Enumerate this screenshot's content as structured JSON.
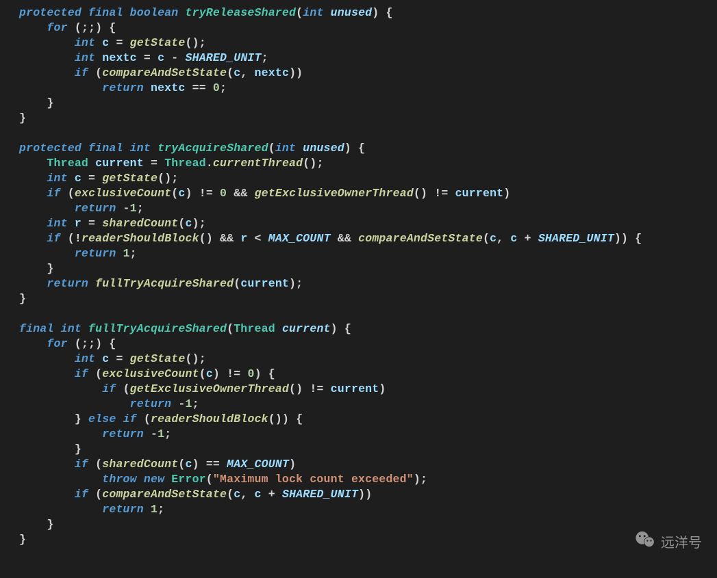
{
  "watermark": {
    "text": "远洋号"
  },
  "code": {
    "lines": [
      [
        [
          "kw",
          "protected"
        ],
        [
          "op",
          " "
        ],
        [
          "kw",
          "final"
        ],
        [
          "op",
          " "
        ],
        [
          "kw",
          "boolean"
        ],
        [
          "op",
          " "
        ],
        [
          "fn",
          "tryReleaseShared"
        ],
        [
          "pun",
          "("
        ],
        [
          "type",
          "int"
        ],
        [
          "op",
          " "
        ],
        [
          "par",
          "unused"
        ],
        [
          "pun",
          ")"
        ],
        [
          "op",
          " "
        ],
        [
          "pun",
          "{"
        ]
      ],
      [
        [
          "op",
          "    "
        ],
        [
          "kw",
          "for"
        ],
        [
          "op",
          " "
        ],
        [
          "pun",
          "("
        ],
        [
          "pun",
          ";"
        ],
        [
          "pun",
          ";"
        ],
        [
          "pun",
          ")"
        ],
        [
          "op",
          " "
        ],
        [
          "pun",
          "{"
        ]
      ],
      [
        [
          "op",
          "        "
        ],
        [
          "type",
          "int"
        ],
        [
          "op",
          " "
        ],
        [
          "id",
          "c"
        ],
        [
          "op",
          " = "
        ],
        [
          "call",
          "getState"
        ],
        [
          "pun",
          "("
        ],
        [
          "pun",
          ")"
        ],
        [
          "pun",
          ";"
        ]
      ],
      [
        [
          "op",
          "        "
        ],
        [
          "type",
          "int"
        ],
        [
          "op",
          " "
        ],
        [
          "id",
          "nextc"
        ],
        [
          "op",
          " = "
        ],
        [
          "id",
          "c"
        ],
        [
          "op",
          " - "
        ],
        [
          "cst",
          "SHARED_UNIT"
        ],
        [
          "pun",
          ";"
        ]
      ],
      [
        [
          "op",
          "        "
        ],
        [
          "kw",
          "if"
        ],
        [
          "op",
          " "
        ],
        [
          "pun",
          "("
        ],
        [
          "call",
          "compareAndSetState"
        ],
        [
          "pun",
          "("
        ],
        [
          "id",
          "c"
        ],
        [
          "pun",
          ","
        ],
        [
          "op",
          " "
        ],
        [
          "id",
          "nextc"
        ],
        [
          "pun",
          ")"
        ],
        [
          "pun",
          ")"
        ]
      ],
      [
        [
          "op",
          "            "
        ],
        [
          "kw",
          "return"
        ],
        [
          "op",
          " "
        ],
        [
          "id",
          "nextc"
        ],
        [
          "op",
          " == "
        ],
        [
          "num",
          "0"
        ],
        [
          "pun",
          ";"
        ]
      ],
      [
        [
          "op",
          "    "
        ],
        [
          "pun",
          "}"
        ]
      ],
      [
        [
          "pun",
          "}"
        ]
      ],
      [
        [
          "op",
          ""
        ]
      ],
      [
        [
          "kw",
          "protected"
        ],
        [
          "op",
          " "
        ],
        [
          "kw",
          "final"
        ],
        [
          "op",
          " "
        ],
        [
          "kw",
          "int"
        ],
        [
          "op",
          " "
        ],
        [
          "fn",
          "tryAcquireShared"
        ],
        [
          "pun",
          "("
        ],
        [
          "type",
          "int"
        ],
        [
          "op",
          " "
        ],
        [
          "par",
          "unused"
        ],
        [
          "pun",
          ")"
        ],
        [
          "op",
          " "
        ],
        [
          "pun",
          "{"
        ]
      ],
      [
        [
          "op",
          "    "
        ],
        [
          "cls",
          "Thread"
        ],
        [
          "op",
          " "
        ],
        [
          "id",
          "current"
        ],
        [
          "op",
          " = "
        ],
        [
          "cls",
          "Thread"
        ],
        [
          "pun",
          "."
        ],
        [
          "call",
          "currentThread"
        ],
        [
          "pun",
          "("
        ],
        [
          "pun",
          ")"
        ],
        [
          "pun",
          ";"
        ]
      ],
      [
        [
          "op",
          "    "
        ],
        [
          "type",
          "int"
        ],
        [
          "op",
          " "
        ],
        [
          "id",
          "c"
        ],
        [
          "op",
          " = "
        ],
        [
          "call",
          "getState"
        ],
        [
          "pun",
          "("
        ],
        [
          "pun",
          ")"
        ],
        [
          "pun",
          ";"
        ]
      ],
      [
        [
          "op",
          "    "
        ],
        [
          "kw",
          "if"
        ],
        [
          "op",
          " "
        ],
        [
          "pun",
          "("
        ],
        [
          "call",
          "exclusiveCount"
        ],
        [
          "pun",
          "("
        ],
        [
          "id",
          "c"
        ],
        [
          "pun",
          ")"
        ],
        [
          "op",
          " != "
        ],
        [
          "num",
          "0"
        ],
        [
          "op",
          " && "
        ],
        [
          "call",
          "getExclusiveOwnerThread"
        ],
        [
          "pun",
          "("
        ],
        [
          "pun",
          ")"
        ],
        [
          "op",
          " != "
        ],
        [
          "id",
          "current"
        ],
        [
          "pun",
          ")"
        ]
      ],
      [
        [
          "op",
          "        "
        ],
        [
          "kw",
          "return"
        ],
        [
          "op",
          " -"
        ],
        [
          "num",
          "1"
        ],
        [
          "pun",
          ";"
        ]
      ],
      [
        [
          "op",
          "    "
        ],
        [
          "type",
          "int"
        ],
        [
          "op",
          " "
        ],
        [
          "id",
          "r"
        ],
        [
          "op",
          " = "
        ],
        [
          "call",
          "sharedCount"
        ],
        [
          "pun",
          "("
        ],
        [
          "id",
          "c"
        ],
        [
          "pun",
          ")"
        ],
        [
          "pun",
          ";"
        ]
      ],
      [
        [
          "op",
          "    "
        ],
        [
          "kw",
          "if"
        ],
        [
          "op",
          " "
        ],
        [
          "pun",
          "("
        ],
        [
          "op",
          "!"
        ],
        [
          "call",
          "readerShouldBlock"
        ],
        [
          "pun",
          "("
        ],
        [
          "pun",
          ")"
        ],
        [
          "op",
          " && "
        ],
        [
          "id",
          "r"
        ],
        [
          "op",
          " < "
        ],
        [
          "cst",
          "MAX_COUNT"
        ],
        [
          "op",
          " && "
        ],
        [
          "call",
          "compareAndSetState"
        ],
        [
          "pun",
          "("
        ],
        [
          "id",
          "c"
        ],
        [
          "pun",
          ","
        ],
        [
          "op",
          " "
        ],
        [
          "id",
          "c"
        ],
        [
          "op",
          " + "
        ],
        [
          "cst",
          "SHARED_UNIT"
        ],
        [
          "pun",
          ")"
        ],
        [
          "pun",
          ")"
        ],
        [
          "op",
          " "
        ],
        [
          "pun",
          "{"
        ]
      ],
      [
        [
          "op",
          "        "
        ],
        [
          "kw",
          "return"
        ],
        [
          "op",
          " "
        ],
        [
          "num",
          "1"
        ],
        [
          "pun",
          ";"
        ]
      ],
      [
        [
          "op",
          "    "
        ],
        [
          "pun",
          "}"
        ]
      ],
      [
        [
          "op",
          "    "
        ],
        [
          "kw",
          "return"
        ],
        [
          "op",
          " "
        ],
        [
          "call",
          "fullTryAcquireShared"
        ],
        [
          "pun",
          "("
        ],
        [
          "id",
          "current"
        ],
        [
          "pun",
          ")"
        ],
        [
          "pun",
          ";"
        ]
      ],
      [
        [
          "pun",
          "}"
        ]
      ],
      [
        [
          "op",
          ""
        ]
      ],
      [
        [
          "kw",
          "final"
        ],
        [
          "op",
          " "
        ],
        [
          "kw",
          "int"
        ],
        [
          "op",
          " "
        ],
        [
          "fn",
          "fullTryAcquireShared"
        ],
        [
          "pun",
          "("
        ],
        [
          "cls",
          "Thread"
        ],
        [
          "op",
          " "
        ],
        [
          "par",
          "current"
        ],
        [
          "pun",
          ")"
        ],
        [
          "op",
          " "
        ],
        [
          "pun",
          "{"
        ]
      ],
      [
        [
          "op",
          "    "
        ],
        [
          "kw",
          "for"
        ],
        [
          "op",
          " "
        ],
        [
          "pun",
          "("
        ],
        [
          "pun",
          ";"
        ],
        [
          "pun",
          ";"
        ],
        [
          "pun",
          ")"
        ],
        [
          "op",
          " "
        ],
        [
          "pun",
          "{"
        ]
      ],
      [
        [
          "op",
          "        "
        ],
        [
          "type",
          "int"
        ],
        [
          "op",
          " "
        ],
        [
          "id",
          "c"
        ],
        [
          "op",
          " = "
        ],
        [
          "call",
          "getState"
        ],
        [
          "pun",
          "("
        ],
        [
          "pun",
          ")"
        ],
        [
          "pun",
          ";"
        ]
      ],
      [
        [
          "op",
          "        "
        ],
        [
          "kw",
          "if"
        ],
        [
          "op",
          " "
        ],
        [
          "pun",
          "("
        ],
        [
          "call",
          "exclusiveCount"
        ],
        [
          "pun",
          "("
        ],
        [
          "id",
          "c"
        ],
        [
          "pun",
          ")"
        ],
        [
          "op",
          " != "
        ],
        [
          "num",
          "0"
        ],
        [
          "pun",
          ")"
        ],
        [
          "op",
          " "
        ],
        [
          "pun",
          "{"
        ]
      ],
      [
        [
          "op",
          "            "
        ],
        [
          "kw",
          "if"
        ],
        [
          "op",
          " "
        ],
        [
          "pun",
          "("
        ],
        [
          "call",
          "getExclusiveOwnerThread"
        ],
        [
          "pun",
          "("
        ],
        [
          "pun",
          ")"
        ],
        [
          "op",
          " != "
        ],
        [
          "id",
          "current"
        ],
        [
          "pun",
          ")"
        ]
      ],
      [
        [
          "op",
          "                "
        ],
        [
          "kw",
          "return"
        ],
        [
          "op",
          " -"
        ],
        [
          "num",
          "1"
        ],
        [
          "pun",
          ";"
        ]
      ],
      [
        [
          "op",
          "        "
        ],
        [
          "pun",
          "}"
        ],
        [
          "op",
          " "
        ],
        [
          "kw",
          "else"
        ],
        [
          "op",
          " "
        ],
        [
          "kw",
          "if"
        ],
        [
          "op",
          " "
        ],
        [
          "pun",
          "("
        ],
        [
          "call",
          "readerShouldBlock"
        ],
        [
          "pun",
          "("
        ],
        [
          "pun",
          ")"
        ],
        [
          "pun",
          ")"
        ],
        [
          "op",
          " "
        ],
        [
          "pun",
          "{"
        ]
      ],
      [
        [
          "op",
          "            "
        ],
        [
          "kw",
          "return"
        ],
        [
          "op",
          " -"
        ],
        [
          "num",
          "1"
        ],
        [
          "pun",
          ";"
        ]
      ],
      [
        [
          "op",
          "        "
        ],
        [
          "pun",
          "}"
        ]
      ],
      [
        [
          "op",
          "        "
        ],
        [
          "kw",
          "if"
        ],
        [
          "op",
          " "
        ],
        [
          "pun",
          "("
        ],
        [
          "call",
          "sharedCount"
        ],
        [
          "pun",
          "("
        ],
        [
          "id",
          "c"
        ],
        [
          "pun",
          ")"
        ],
        [
          "op",
          " == "
        ],
        [
          "cst",
          "MAX_COUNT"
        ],
        [
          "pun",
          ")"
        ]
      ],
      [
        [
          "op",
          "            "
        ],
        [
          "kw",
          "throw"
        ],
        [
          "op",
          " "
        ],
        [
          "kw",
          "new"
        ],
        [
          "op",
          " "
        ],
        [
          "cls",
          "Error"
        ],
        [
          "pun",
          "("
        ],
        [
          "str",
          "\"Maximum lock count exceeded\""
        ],
        [
          "pun",
          ")"
        ],
        [
          "pun",
          ";"
        ]
      ],
      [
        [
          "op",
          "        "
        ],
        [
          "kw",
          "if"
        ],
        [
          "op",
          " "
        ],
        [
          "pun",
          "("
        ],
        [
          "call",
          "compareAndSetState"
        ],
        [
          "pun",
          "("
        ],
        [
          "id",
          "c"
        ],
        [
          "pun",
          ","
        ],
        [
          "op",
          " "
        ],
        [
          "id",
          "c"
        ],
        [
          "op",
          " + "
        ],
        [
          "cst",
          "SHARED_UNIT"
        ],
        [
          "pun",
          ")"
        ],
        [
          "pun",
          ")"
        ]
      ],
      [
        [
          "op",
          "            "
        ],
        [
          "kw",
          "return"
        ],
        [
          "op",
          " "
        ],
        [
          "num",
          "1"
        ],
        [
          "pun",
          ";"
        ]
      ],
      [
        [
          "op",
          "    "
        ],
        [
          "pun",
          "}"
        ]
      ],
      [
        [
          "pun",
          "}"
        ]
      ]
    ]
  }
}
